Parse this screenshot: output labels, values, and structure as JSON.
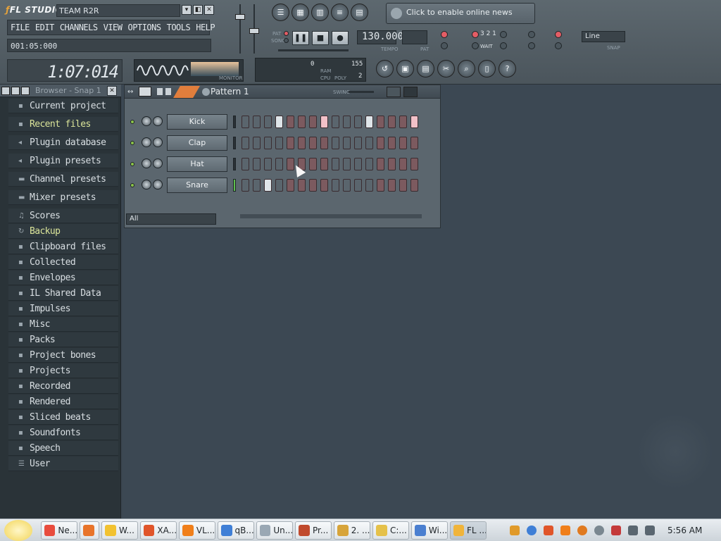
{
  "app": {
    "logo": "FL STUDIO",
    "project_name": "TEAM R2R",
    "window_buttons": [
      "▾",
      "◧",
      "✕"
    ]
  },
  "menu": [
    "FILE",
    "EDIT",
    "CHANNELS",
    "VIEW",
    "OPTIONS",
    "TOOLS",
    "HELP"
  ],
  "hint": "001:05:000",
  "time_display": "1:07:014",
  "monitor_label": "MONITOR",
  "cpu": {
    "ram": "0",
    "poly_value": "155",
    "poly": "2",
    "ram_label": "RAM",
    "cpu_label": "CPU",
    "poly_label": "POLY"
  },
  "news": "Click to enable online news",
  "transport": {
    "pat_label": "PAT",
    "song_label": "SONG",
    "pause": "❚❚",
    "stop": "■",
    "record": "●",
    "tempo": "130.000",
    "tempo_label": "TEMPO",
    "pat_caption": "PAT"
  },
  "options": {
    "snap": "Line",
    "snap_label": "SNAP",
    "count": "3 2 1",
    "wait": "WAIT"
  },
  "browser": {
    "title": "Browser - Snap 1",
    "items": [
      {
        "label": "Current project",
        "icon": "folder-icon"
      },
      {
        "label": "Recent files",
        "icon": "folder-icon",
        "accent": true
      },
      {
        "label": "Plugin database",
        "icon": "plug-icon"
      },
      {
        "label": "Plugin presets",
        "icon": "plug-icon"
      },
      {
        "label": "Channel presets",
        "icon": "channel-icon"
      },
      {
        "label": "Mixer presets",
        "icon": "mixer-icon"
      },
      {
        "label": "Scores",
        "icon": "note-icon"
      },
      {
        "label": "Backup",
        "icon": "backup-icon",
        "accent": true
      },
      {
        "label": "Clipboard files",
        "icon": "folder-icon"
      },
      {
        "label": "Collected",
        "icon": "folder-icon"
      },
      {
        "label": "Envelopes",
        "icon": "folder-icon"
      },
      {
        "label": "IL Shared Data",
        "icon": "folder-icon"
      },
      {
        "label": "Impulses",
        "icon": "folder-icon"
      },
      {
        "label": "Misc",
        "icon": "folder-icon"
      },
      {
        "label": "Packs",
        "icon": "folder-icon"
      },
      {
        "label": "Project bones",
        "icon": "folder-icon"
      },
      {
        "label": "Projects",
        "icon": "folder-icon"
      },
      {
        "label": "Recorded",
        "icon": "folder-icon"
      },
      {
        "label": "Rendered",
        "icon": "folder-icon"
      },
      {
        "label": "Sliced beats",
        "icon": "folder-icon"
      },
      {
        "label": "Soundfonts",
        "icon": "folder-icon"
      },
      {
        "label": "Speech",
        "icon": "folder-icon"
      },
      {
        "label": "User",
        "icon": "user-icon"
      }
    ]
  },
  "sequencer": {
    "pattern": "Pattern 1",
    "swing_label": "SWING",
    "filter": "All",
    "channels": [
      {
        "name": "Kick",
        "steps": [
          0,
          0,
          0,
          1,
          0,
          0,
          0,
          1,
          0,
          0,
          0,
          1,
          0,
          0,
          0,
          1
        ]
      },
      {
        "name": "Clap",
        "steps": [
          0,
          0,
          0,
          0,
          0,
          0,
          0,
          0,
          0,
          0,
          0,
          0,
          0,
          0,
          0,
          0
        ]
      },
      {
        "name": "Hat",
        "steps": [
          0,
          0,
          0,
          0,
          0,
          0,
          0,
          0,
          0,
          0,
          0,
          0,
          0,
          0,
          0,
          0
        ]
      },
      {
        "name": "Snare",
        "steps": [
          0,
          0,
          1,
          0,
          0,
          0,
          0,
          0,
          0,
          0,
          0,
          0,
          0,
          0,
          0,
          0
        ]
      }
    ]
  },
  "taskbar": {
    "tasks": [
      {
        "label": "Ne...",
        "color": "#e84c3d"
      },
      {
        "label": "",
        "color": "#e8742a"
      },
      {
        "label": "W...",
        "color": "#f2c230"
      },
      {
        "label": "XA...",
        "color": "#e0552a"
      },
      {
        "label": "VL...",
        "color": "#f07f1a"
      },
      {
        "label": "qB...",
        "color": "#3f7fd6"
      },
      {
        "label": "Un...",
        "color": "#9aa8b4"
      },
      {
        "label": "Pr...",
        "color": "#c04a2d"
      },
      {
        "label": "2. ...",
        "color": "#d7a43a"
      },
      {
        "label": "C:...",
        "color": "#e5c14a"
      },
      {
        "label": "Wi...",
        "color": "#4a7fd0"
      },
      {
        "label": "FL ...",
        "color": "#f0b43a",
        "active": true
      }
    ],
    "clock": "5:56 AM"
  }
}
